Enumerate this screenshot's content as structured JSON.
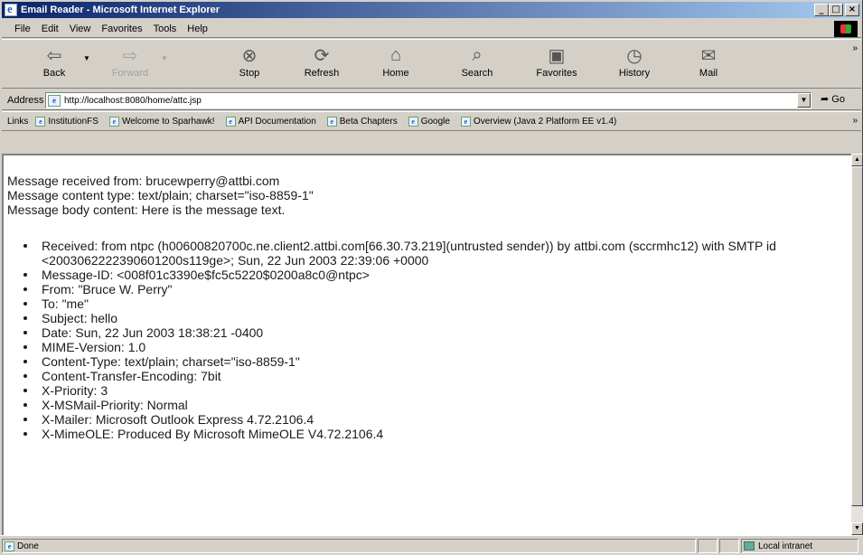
{
  "window": {
    "title": "Email Reader - Microsoft Internet Explorer"
  },
  "menu": {
    "items": [
      {
        "label": "File"
      },
      {
        "label": "Edit"
      },
      {
        "label": "View"
      },
      {
        "label": "Favorites"
      },
      {
        "label": "Tools"
      },
      {
        "label": "Help"
      }
    ]
  },
  "toolbar": {
    "back": "Back",
    "forward": "Forward",
    "stop": "Stop",
    "refresh": "Refresh",
    "home": "Home",
    "search": "Search",
    "favorites": "Favorites",
    "history": "History",
    "mail": "Mail"
  },
  "address": {
    "label": "Address",
    "url": "http://localhost:8080/home/attc.jsp",
    "go": "Go"
  },
  "links": {
    "label": "Links",
    "items": [
      {
        "label": "InstitutionFS"
      },
      {
        "label": "Welcome to Sparhawk!"
      },
      {
        "label": "API Documentation"
      },
      {
        "label": "Beta Chapters"
      },
      {
        "label": "Google"
      },
      {
        "label": "Overview (Java 2 Platform EE v1.4)"
      }
    ]
  },
  "content": {
    "line1": "Message received from: brucewperry@attbi.com",
    "line2": "Message content type: text/plain; charset=\"iso-8859-1\"",
    "line3": "Message body content: Here is the message text.",
    "headers": [
      "Received: from ntpc (h00600820700c.ne.client2.attbi.com[66.30.73.219](untrusted sender)) by attbi.com (sccrmhc12) with SMTP id <2003062222390601200s119ge>; Sun, 22 Jun 2003 22:39:06 +0000",
      "Message-ID: <008f01c3390e$fc5c5220$0200a8c0@ntpc>",
      "From: \"Bruce W. Perry\"",
      "To: \"me\"",
      "Subject: hello",
      "Date: Sun, 22 Jun 2003 18:38:21 -0400",
      "MIME-Version: 1.0",
      "Content-Type: text/plain; charset=\"iso-8859-1\"",
      "Content-Transfer-Encoding: 7bit",
      "X-Priority: 3",
      "X-MSMail-Priority: Normal",
      "X-Mailer: Microsoft Outlook Express 4.72.2106.4",
      "X-MimeOLE: Produced By Microsoft MimeOLE V4.72.2106.4"
    ]
  },
  "status": {
    "text": "Done",
    "zone": "Local intranet"
  },
  "colors": {
    "titlebar_start": "#0a246a",
    "titlebar_end": "#a6caf0",
    "chrome": "#d4d0c8"
  }
}
